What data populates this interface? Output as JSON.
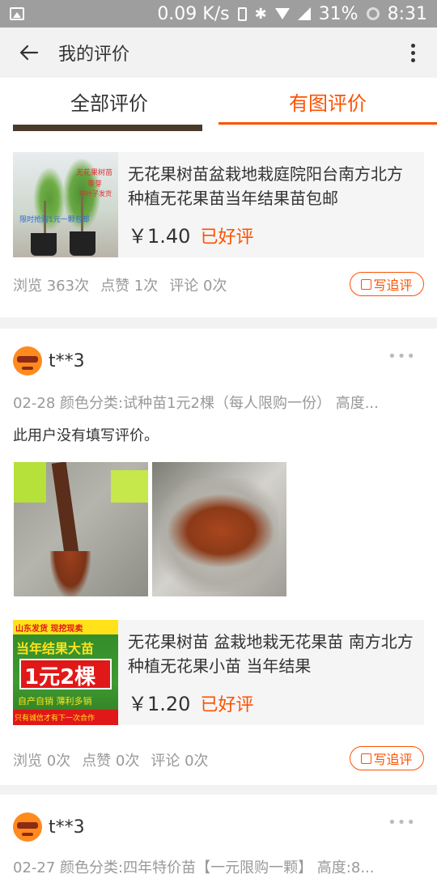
{
  "status_bar": {
    "speed": "0.09 K/s",
    "battery": "31%",
    "time": "8:31"
  },
  "header": {
    "title": "我的评价"
  },
  "tabs": [
    {
      "label": "全部评价",
      "active": false
    },
    {
      "label": "有图评价",
      "active": true
    }
  ],
  "colors": {
    "accent": "#ff5000"
  },
  "reviews": [
    {
      "product": {
        "title": "无花果树苗盆栽地栽庭院阳台南方北方种植无花果苗当年结果苗包邮",
        "price": "￥1.40",
        "tag": "已好评",
        "image_text": {
          "t1": "无花果树苗",
          "t2": "带芽",
          "t3": "带叶子发货",
          "t4": "限时抢购1元一颗包邮"
        }
      },
      "stats": {
        "views": "浏览 363次",
        "likes": "点赞 1次",
        "comments": "评论 0次"
      },
      "follow_label": "写追评"
    },
    {
      "user": "t**3",
      "meta": "02-28  颜色分类:试种苗1元2棵（每人限购一份） 高度...",
      "text": "此用户没有填写评价。",
      "product": {
        "title": "无花果树苗 盆栽地栽无花果苗 南方北方种植无花果小苗 当年结果",
        "price": "￥1.20",
        "tag": "已好评",
        "image_text": {
          "t1": "山东发货 现挖现卖",
          "t2": "当年结果大苗",
          "t3": "1元2棵",
          "t4": "自产自销 薄利多销",
          "t5": "只有诚信才有下一次合作"
        }
      },
      "stats": {
        "views": "浏览 0次",
        "likes": "点赞 0次",
        "comments": "评论 0次"
      },
      "follow_label": "写追评"
    },
    {
      "user": "t**3",
      "meta": "02-27  颜色分类:四年特价苗【一元限购一颗】 高度:8..."
    }
  ]
}
